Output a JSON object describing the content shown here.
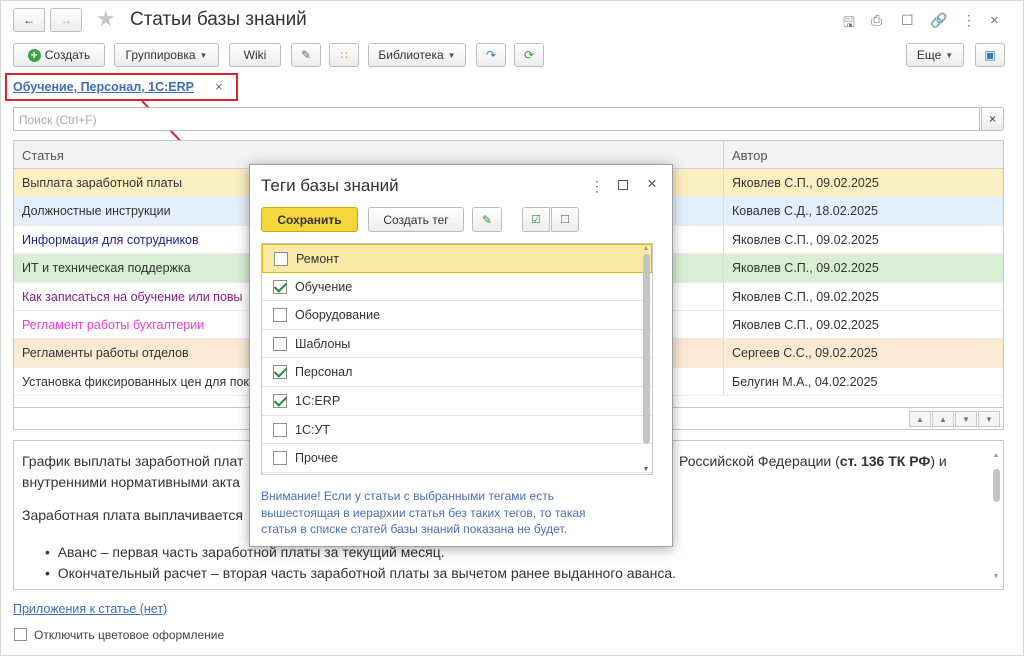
{
  "window": {
    "title": "Статьи базы знаний"
  },
  "toolbar": {
    "create": "Создать",
    "grouping": "Группировка",
    "wiki": "Wiki",
    "library": "Библиотека",
    "more": "Еще"
  },
  "filter_tag": {
    "label": "Обучение, Персонал, 1С:ERP",
    "close": "×"
  },
  "search": {
    "placeholder": "Поиск (Ctrl+F)",
    "clear": "×"
  },
  "table": {
    "headers": {
      "article": "Статья",
      "author": "Автор"
    },
    "rows": [
      {
        "article": "Выплата заработной платы",
        "author": "Яковлев С.П., 09.02.2025",
        "bg": "#fcefc1",
        "color": "#333333"
      },
      {
        "article": "Должностные инструкции",
        "author": "Ковалев С.Д., 18.02.2025",
        "bg": "#e3f0fb",
        "color": "#333333"
      },
      {
        "article": "Информация для сотрудников",
        "author": "Яковлев С.П., 09.02.2025",
        "bg": "#ffffff",
        "color": "#1f1f8f"
      },
      {
        "article": "ИТ и техническая поддержка",
        "author": "Яковлев С.П., 09.02.2025",
        "bg": "#d9efd3",
        "color": "#333333"
      },
      {
        "article": "Как записаться на обучение или повы",
        "author": "Яковлев С.П., 09.02.2025",
        "bg": "#ffffff",
        "color": "#8b1c8b"
      },
      {
        "article": "Регламент работы бухгалтерии",
        "author": "Яковлев С.П., 09.02.2025",
        "bg": "#ffffff",
        "color": "#e23fd4"
      },
      {
        "article": "Регламенты работы отделов",
        "author": "Сергеев С.С., 09.02.2025",
        "bg": "#fbe9d4",
        "color": "#333333"
      },
      {
        "article": "Установка фиксированных цен для пок",
        "author": "Белугин М.А., 04.02.2025",
        "bg": "#ffffff",
        "color": "#333333"
      }
    ]
  },
  "content": {
    "line1_start": "График выплаты заработной плат",
    "line1_end_pre": "Российской Федерации (",
    "line1_bold": "ст. 136 ТК РФ",
    "line1_end_post": ") и",
    "line2": "внутренними нормативными акта",
    "line3": "Заработная плата выплачивается",
    "bullets": [
      "Аванс – первая часть заработной платы за текущий месяц.",
      "Окончательный расчет – вторая часть заработной платы за вычетом ранее выданного аванса."
    ]
  },
  "attachments_link": "Приложения к статье (нет)",
  "disable_color": "Отключить цветовое оформление",
  "dialog": {
    "title": "Теги базы знаний",
    "save": "Сохранить",
    "create_tag": "Создать тег",
    "tags": [
      {
        "label": "Ремонт",
        "checked": false
      },
      {
        "label": "Обучение",
        "checked": true
      },
      {
        "label": "Оборудование",
        "checked": false
      },
      {
        "label": "Шаблоны",
        "checked": false
      },
      {
        "label": "Персонал",
        "checked": true
      },
      {
        "label": "1С:ERP",
        "checked": true
      },
      {
        "label": "1С:УТ",
        "checked": false
      },
      {
        "label": "Прочее",
        "checked": false
      }
    ],
    "warning": "Внимание! Если у статьи с выбранными тегами есть вышестоящая в иерархии статья без таких тегов, то такая статья в списке статей базы знаний показана не будет."
  },
  "colors": {
    "accent_red": "#e0232a",
    "save_yellow": "#f5d63c",
    "link_blue": "#3d6fb6"
  }
}
